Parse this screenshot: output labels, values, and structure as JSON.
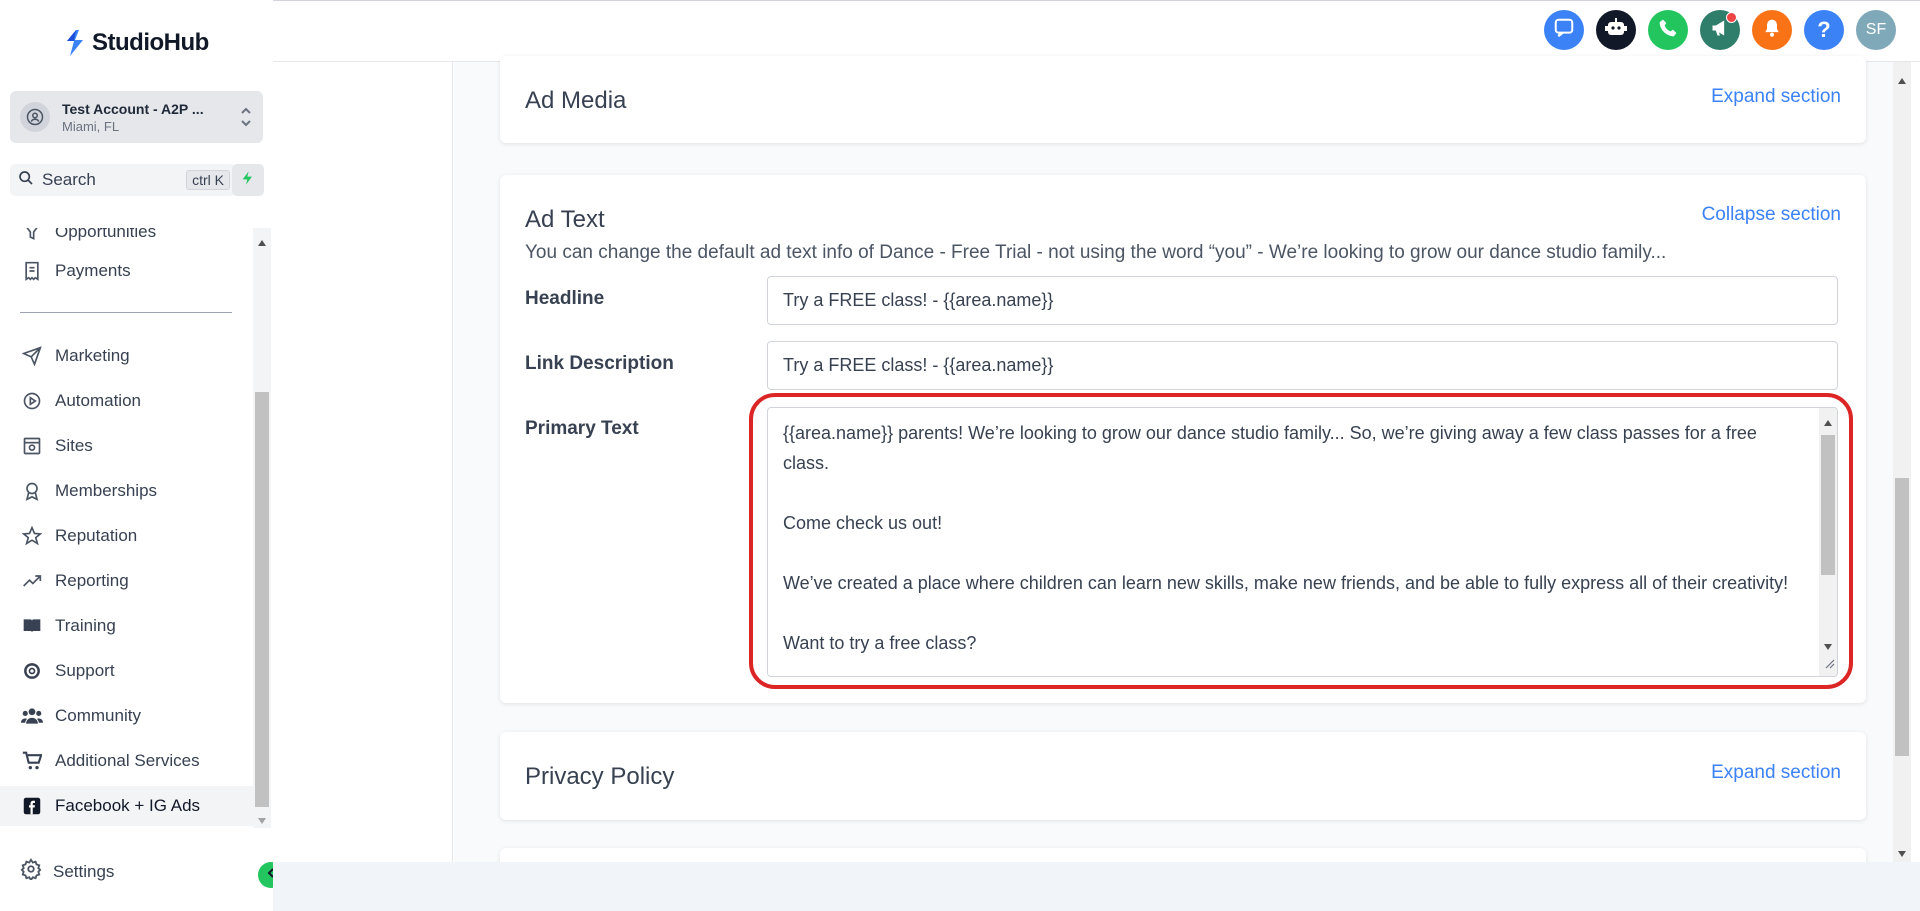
{
  "app": {
    "name": "StudioHub"
  },
  "account": {
    "name": "Test Account - A2P ...",
    "location": "Miami, FL"
  },
  "search": {
    "label": "Search",
    "shortcut": "ctrl K"
  },
  "sidebar": {
    "partial_item": "Opportunities",
    "items": [
      {
        "label": "Payments",
        "icon": "receipt-icon"
      },
      {
        "label": "Marketing",
        "icon": "send-icon"
      },
      {
        "label": "Automation",
        "icon": "automation-icon"
      },
      {
        "label": "Sites",
        "icon": "sites-icon"
      },
      {
        "label": "Memberships",
        "icon": "award-icon"
      },
      {
        "label": "Reputation",
        "icon": "star-icon"
      },
      {
        "label": "Reporting",
        "icon": "trend-icon"
      },
      {
        "label": "Training",
        "icon": "book-icon"
      },
      {
        "label": "Support",
        "icon": "lifebuoy-icon"
      },
      {
        "label": "Community",
        "icon": "users-icon"
      },
      {
        "label": "Additional Services",
        "icon": "cart-icon"
      },
      {
        "label": "Facebook + IG Ads",
        "icon": "facebook-icon",
        "active": true
      }
    ],
    "settings_label": "Settings"
  },
  "topbar": {
    "user_initials": "SF",
    "colors": {
      "chat": "#3b82f6",
      "bot": "#111827",
      "phone": "#22c55e",
      "announce": "#2f7d6b",
      "bell": "#f97316",
      "help": "#3b82f6",
      "avatar": "#7fa8b8"
    }
  },
  "sections": {
    "ad_media": {
      "title": "Ad Media",
      "action": "Expand section"
    },
    "ad_text": {
      "title": "Ad Text",
      "action": "Collapse section",
      "description": "You can change the default ad text info of Dance - Free Trial - not using the word “you” - We’re looking to grow our dance studio family...",
      "headline_label": "Headline",
      "headline_value": "Try a FREE class! - {{area.name}}",
      "link_desc_label": "Link Description",
      "link_desc_value": "Try a FREE class! - {{area.name}}",
      "primary_label": "Primary Text",
      "primary_value": "{{area.name}} parents! We’re looking to grow our dance studio family... So, we’re giving away a few class passes for a free class.\n\nCome check us out!\n\nWe’ve created a place where children can learn new skills, make new friends, and be able to fully express all of their creativity!\n\nWant to try a free class?"
    },
    "privacy": {
      "title": "Privacy Policy",
      "action": "Expand section"
    }
  },
  "accent_color": "#3b82f6",
  "highlight_color": "#dc2626"
}
